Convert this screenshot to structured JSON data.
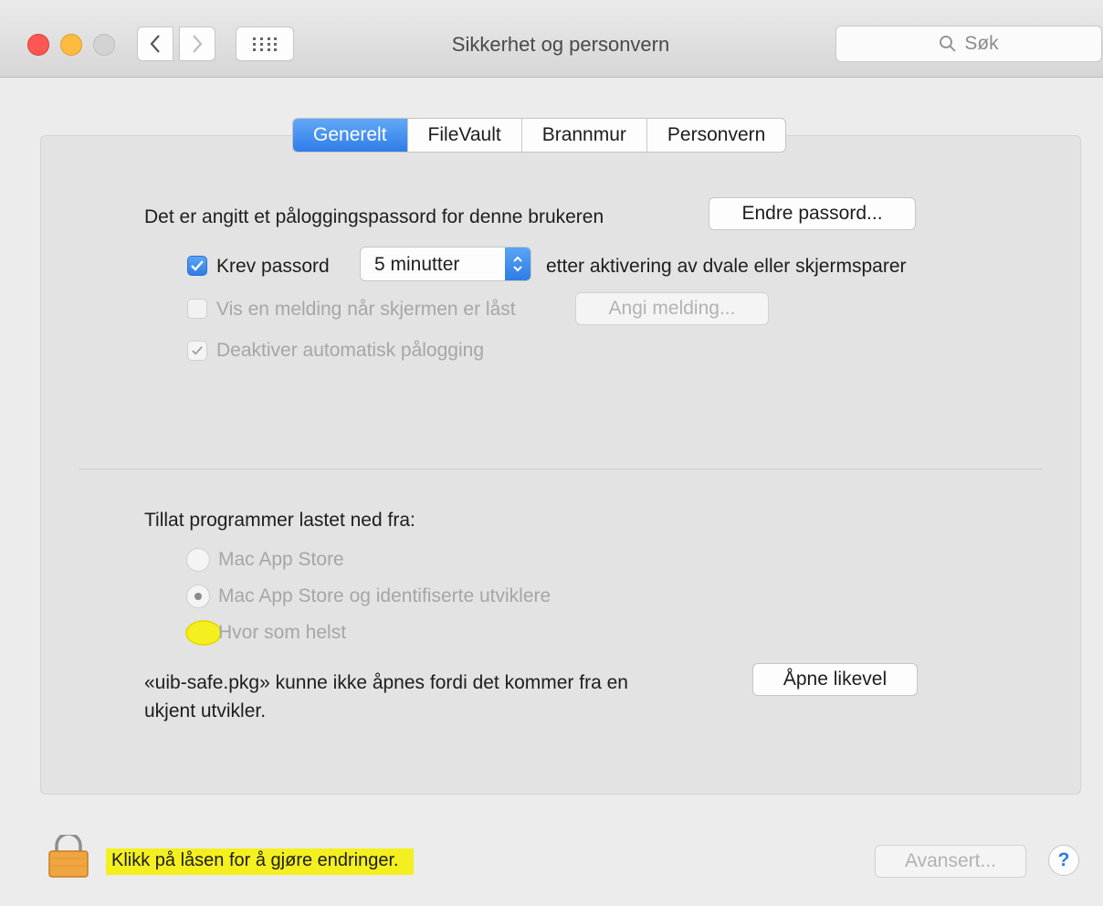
{
  "window": {
    "title": "Sikkerhet og personvern"
  },
  "search": {
    "placeholder": "Søk"
  },
  "tabs": [
    {
      "label": "Generelt",
      "active": true
    },
    {
      "label": "FileVault",
      "active": false
    },
    {
      "label": "Brannmur",
      "active": false
    },
    {
      "label": "Personvern",
      "active": false
    }
  ],
  "general": {
    "password_text": "Det er angitt et påloggingspassord for denne brukeren",
    "change_password_button": "Endre passord...",
    "require_password_label": "Krev passord",
    "require_password_checked": true,
    "require_password_delay": "5 minutter",
    "require_password_suffix": "etter aktivering av dvale eller skjermsparer",
    "show_message_label": "Vis en melding når skjermen er låst",
    "show_message_checked": false,
    "set_message_button": "Angi melding...",
    "disable_autologin_label": "Deaktiver automatisk pålogging",
    "disable_autologin_checked": true
  },
  "allow_apps": {
    "heading": "Tillat programmer lastet ned fra:",
    "options": [
      {
        "label": "Mac App Store",
        "selected": false
      },
      {
        "label": "Mac App Store og identifiserte utviklere",
        "selected": true
      },
      {
        "label": "Hvor som helst",
        "selected": false
      }
    ],
    "blocked_message_line1": "«uib-safe.pkg» kunne ikke åpnes fordi det kommer fra en",
    "blocked_message_line2": "ukjent utvikler.",
    "open_anyway_button": "Åpne likevel"
  },
  "footer": {
    "lock_text": "Klikk på låsen for å gjøre endringer.",
    "advanced_button": "Avansert...",
    "help_label": "?"
  },
  "colors": {
    "accent": "#2f7de8",
    "highlight": "#f4f020",
    "close": "#fc5753",
    "minimize": "#fdbc40"
  },
  "icons": [
    "close-button",
    "minimize-button",
    "zoom-button",
    "chevron-left-icon",
    "chevron-right-icon",
    "grid-icon",
    "search-icon",
    "checkmark-icon",
    "updown-arrows-icon",
    "lock-icon",
    "help-icon"
  ]
}
